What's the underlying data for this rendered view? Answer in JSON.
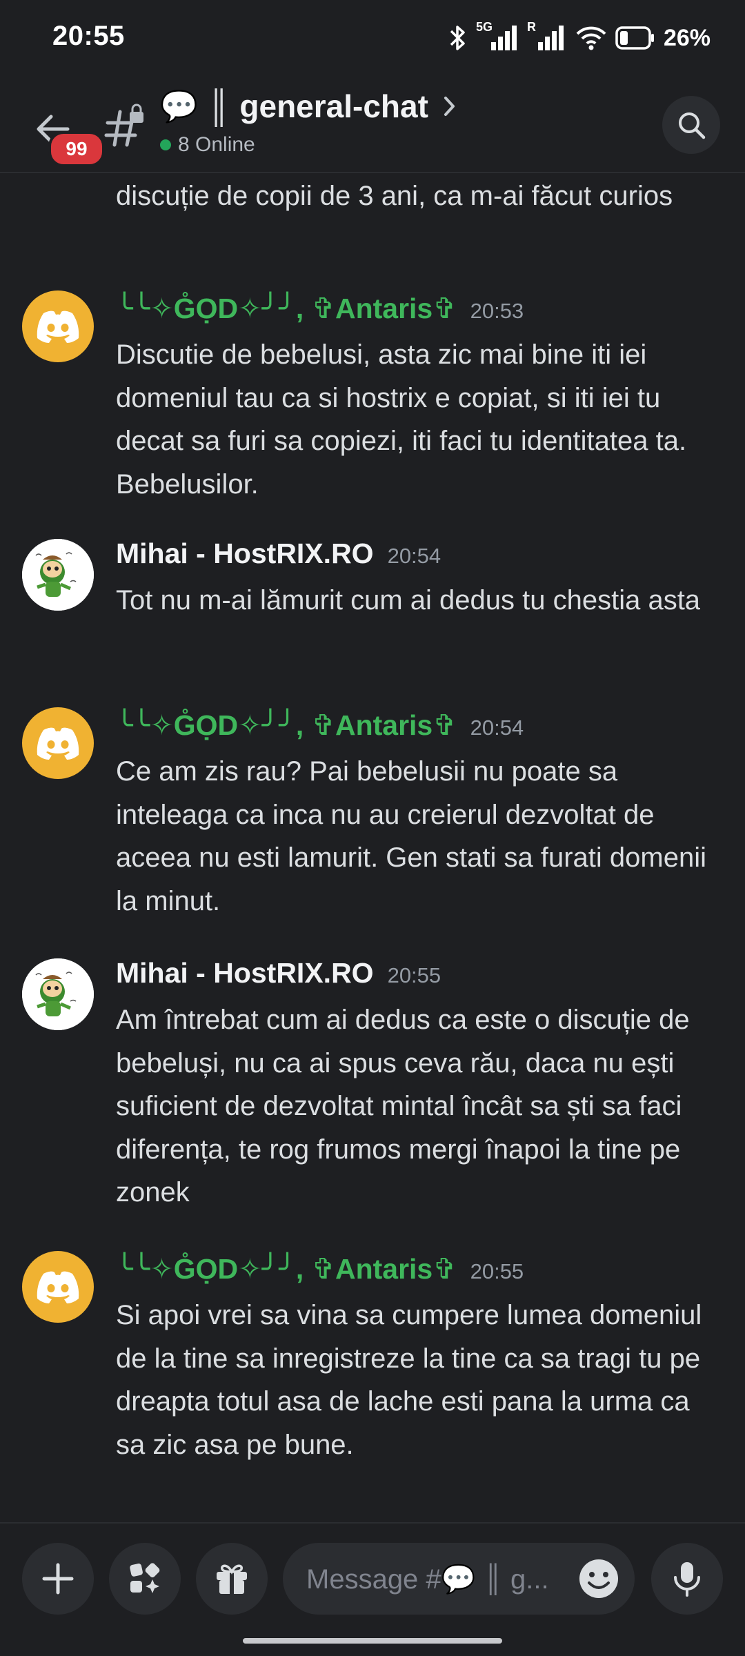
{
  "status_bar": {
    "time": "20:55",
    "battery": "26%",
    "network_5g": "5G",
    "roaming": "R"
  },
  "header": {
    "back_badge": "99",
    "channel_emoji": "💬",
    "channel_separator": "║",
    "channel_name": "general-chat",
    "online_count": "8 Online"
  },
  "messages": [
    {
      "id": "partial",
      "text": "discuție de copii de 3 ani, ca m-ai făcut curios"
    },
    {
      "author": "╰╰✧G̊ỌD✧╯╯, ✞Antaris✞",
      "time": "20:53",
      "text": "Discutie de bebelusi, asta zic mai bine iti iei domeniul tau ca si hostrix e copiat, si iti iei tu decat sa furi sa copiezi, iti faci tu identitatea ta. Bebelusilor."
    },
    {
      "author": "Mihai - HostRIX.RO",
      "time": "20:54",
      "text": "Tot nu m-ai lămurit cum ai dedus tu chestia asta"
    },
    {
      "author": "╰╰✧G̊ỌD✧╯╯, ✞Antaris✞",
      "time": "20:54",
      "text": "Ce am zis rau? Pai bebelusii nu poate sa inteleaga ca inca nu au creierul dezvoltat de aceea nu esti lamurit. Gen stati sa furati domenii la minut."
    },
    {
      "author": "Mihai - HostRIX.RO",
      "time": "20:55",
      "text": "Am întrebat cum ai dedus ca este o discuție de bebeluși, nu ca ai spus ceva rău, daca nu ești suficient de dezvoltat mintal încât sa ști sa faci diferența, te rog frumos mergi înapoi la tine pe zonek"
    },
    {
      "author": "╰╰✧G̊ỌD✧╯╯, ✞Antaris✞",
      "time": "20:55",
      "text": "Si apoi vrei sa vina sa cumpere lumea domeniul de la tine sa inregistreze la tine ca sa tragi tu pe dreapta totul asa de lache esti pana la urma ca sa zic asa pe bune."
    }
  ],
  "composer": {
    "placeholder": "Message #💬 ║ g..."
  },
  "icons": {
    "back": "arrow-left-icon",
    "channel": "locked-text-channel-icon",
    "search": "search-icon",
    "add": "plus-icon",
    "apps": "apps-icon",
    "gift": "gift-icon",
    "emoji": "emoji-icon",
    "mic": "microphone-icon"
  },
  "colors": {
    "background": "#1e1f22",
    "accent_green_name": "#3fb75b",
    "badge_red": "#da373c",
    "discord_avatar": "#f0b232",
    "online": "#23a55a"
  }
}
